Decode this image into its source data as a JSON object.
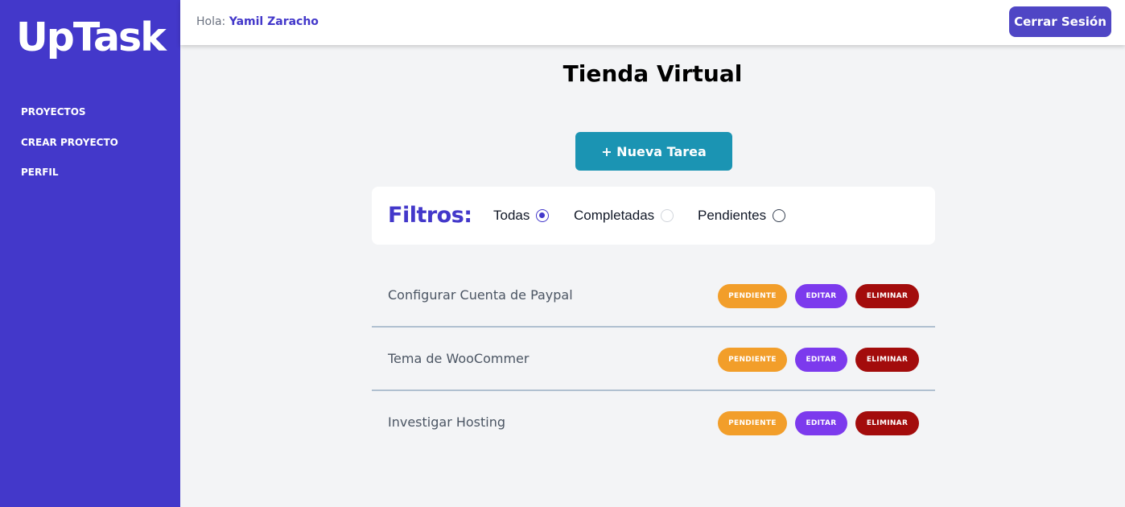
{
  "app": {
    "logo": "UpTask"
  },
  "sidebar": {
    "items": [
      {
        "label": "PROYECTOS"
      },
      {
        "label": "CREAR PROYECTO"
      },
      {
        "label": "PERFIL"
      }
    ]
  },
  "header": {
    "greeting": "Hola:",
    "user": "Yamil Zaracho",
    "logout_label": "Cerrar Sesión"
  },
  "project": {
    "title": "Tienda Virtual",
    "new_task_label": "+ Nueva Tarea"
  },
  "filters": {
    "title": "Filtros:",
    "options": [
      {
        "label": "Todas",
        "selected": true
      },
      {
        "label": "Completadas",
        "selected": false
      },
      {
        "label": "Pendientes",
        "selected": false
      }
    ]
  },
  "tasks": [
    {
      "name": "Configurar Cuenta de Paypal",
      "status": "PENDIENTE",
      "edit": "EDITAR",
      "delete": "ELIMINAR"
    },
    {
      "name": "Tema de WooCommer",
      "status": "PENDIENTE",
      "edit": "EDITAR",
      "delete": "ELIMINAR"
    },
    {
      "name": "Investigar Hosting",
      "status": "PENDIENTE",
      "edit": "EDITAR",
      "delete": "ELIMINAR"
    }
  ],
  "colors": {
    "primary": "#4338ca",
    "accent": "#1b94b3",
    "pending": "#f29e2a",
    "edit": "#7c3aed",
    "delete": "#a30c0c"
  }
}
